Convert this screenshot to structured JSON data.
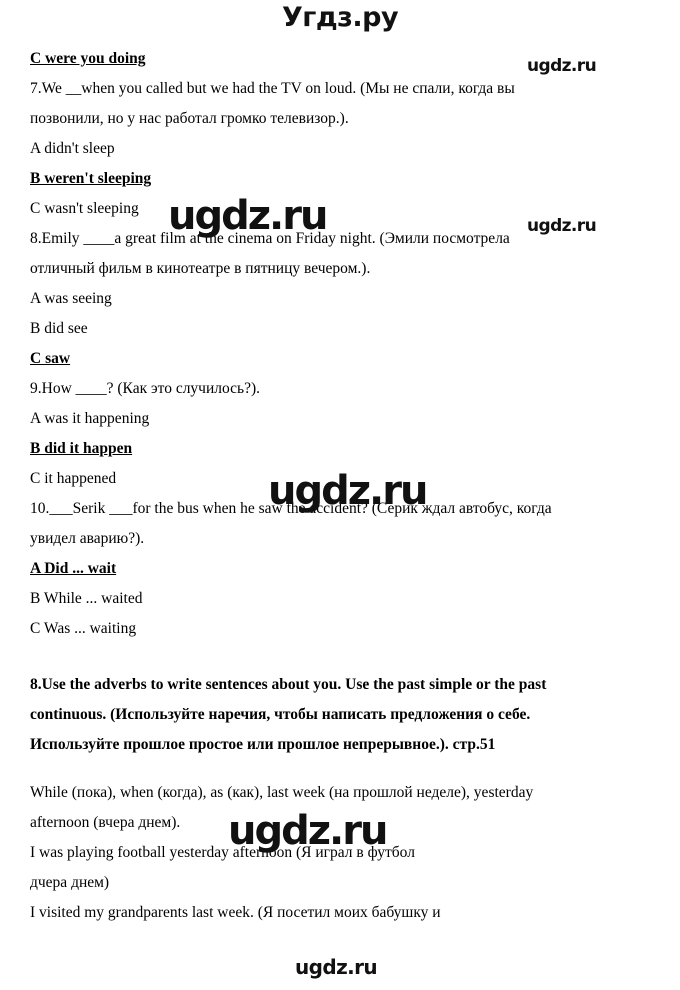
{
  "header": {
    "logo": "Угдз.ру"
  },
  "watermarks": [
    {
      "text": "ugdz.ru",
      "size": "sm"
    },
    {
      "text": "ugdz.ru",
      "size": "lg"
    },
    {
      "text": "ugdz.ru",
      "size": "sm"
    },
    {
      "text": "ugdz.ru",
      "size": "lg"
    },
    {
      "text": "ugdz.ru",
      "size": "md"
    },
    {
      "text": "ugdz.ru",
      "size": "lg"
    }
  ],
  "exercise7": {
    "prev_answer": "C were you doing",
    "question_line1": "7.We __when you called but we had the TV on loud. (Мы не спали, когда вы",
    "question_line2": "позвонили, но у нас работал громко телевизор.).",
    "option_a": "A didn't sleep",
    "option_b": "B weren't sleeping",
    "option_c": "C wasn't sleeping",
    "correct": "B"
  },
  "exercise8q": {
    "question_line1": "8.Emily ____a great film at the cinema on Friday night. (Эмили посмотрела",
    "question_line2": "отличный фильм в кинотеатре в пятницу вечером.).",
    "option_a": "A was seeing",
    "option_b": "B did see",
    "option_c": "C saw",
    "correct": "C"
  },
  "exercise9": {
    "question_line1": "9.How ____? (Как это случилось?).",
    "option_a": "A was it happening",
    "option_b": "B did it happen",
    "option_c": "C it happened",
    "correct": "B"
  },
  "exercise10": {
    "question_line1": "10.___Serik ___for the bus when he saw the accident? (Серик ждал автобус, когда",
    "question_line2": "увидел аварию?).",
    "option_a": "A Did ... wait",
    "option_b": "B While ... waited",
    "option_c": "C Was ... waiting",
    "correct": "A"
  },
  "task8": {
    "heading_line1": "8.Use the adverbs to write sentences about you. Use the past simple or the past",
    "heading_line2": "continuous. (Используйте наречия, чтобы написать предложения о себе.",
    "heading_line3": "Используйте прошлое простое или прошлое непрерывное.). стр.51",
    "adverbs_line1": "While (пока), when (когда), as (как), last week (на прошлой неделе),  yesterday",
    "adverbs_line2": "afternoon (вчера днем).",
    "answer_line1": "I was playing football yesterday afternoon (Я играл в футбол",
    "answer_line2": "дчера днем)",
    "answer_line3": "I visited my grandparents last week. (Я посетил моих бабушку и"
  }
}
